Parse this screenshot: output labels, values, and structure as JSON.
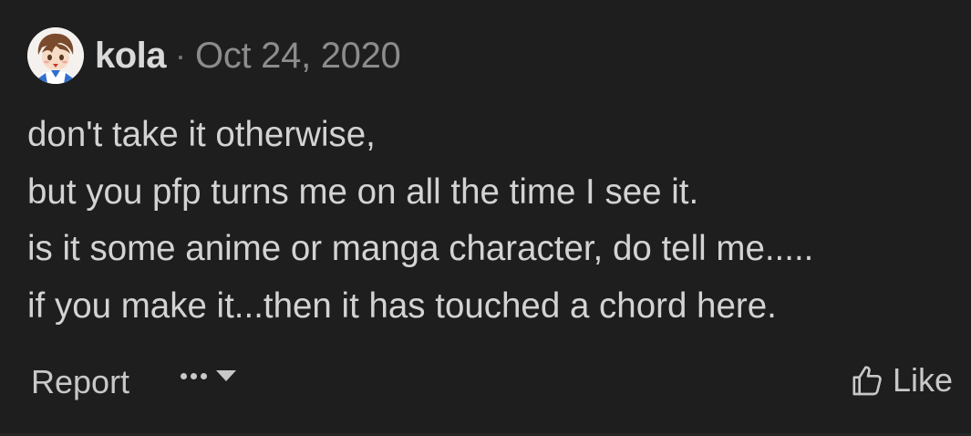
{
  "comment": {
    "author": "kola",
    "separator": "·",
    "date": "Oct 24, 2020",
    "lines": [
      "don't take it otherwise,",
      "but you pfp turns me on all the time I see it.",
      "is it some anime or manga character, do tell me.....",
      "if you make it...then it has touched a chord here."
    ]
  },
  "actions": {
    "report_label": "Report",
    "like_label": "Like",
    "more_icon": "ellipsis-icon",
    "dropdown_icon": "caret-down-icon",
    "like_icon": "thumbs-up-icon"
  },
  "colors": {
    "background": "#1e1e1e",
    "text": "#d3d3d3",
    "muted": "#8c8c8c"
  }
}
